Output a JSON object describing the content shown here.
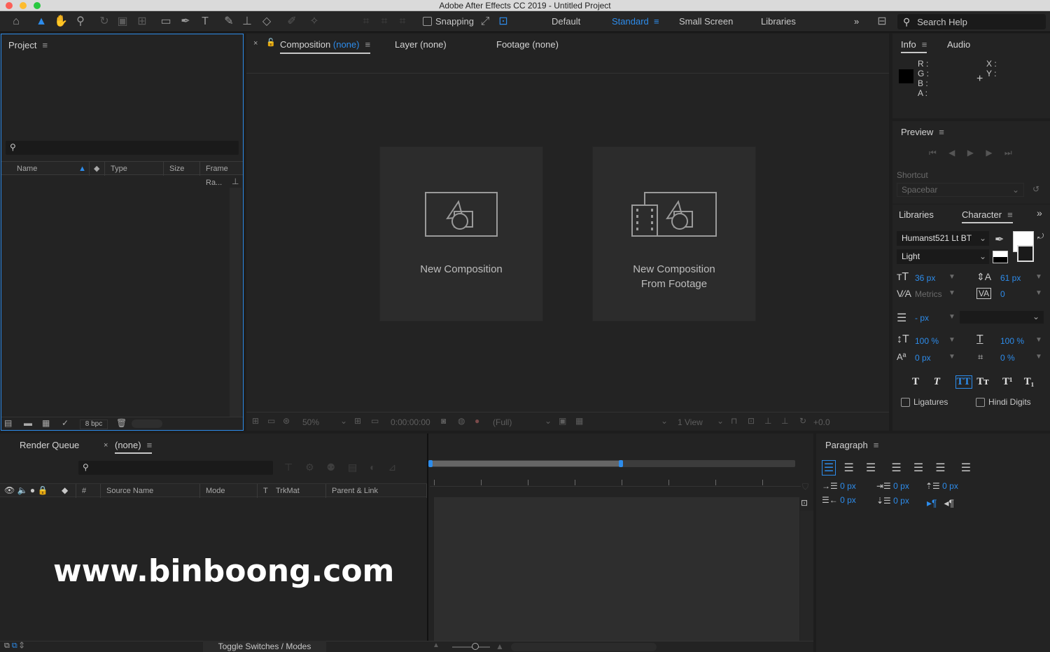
{
  "window": {
    "title": "Adobe After Effects CC 2019 - Untitled Project"
  },
  "toolbar": {
    "snapping_label": "Snapping",
    "workspaces": [
      "Default",
      "Standard",
      "Small Screen",
      "Libraries"
    ],
    "active_workspace": "Standard",
    "search_placeholder": "Search Help"
  },
  "project": {
    "tab_label": "Project",
    "columns": [
      "Name",
      "Type",
      "Size",
      "Frame Ra..."
    ],
    "bpc_label": "8 bpc"
  },
  "viewer": {
    "tabs": [
      {
        "prefix": "Composition",
        "value": "(none)"
      },
      {
        "prefix": "Layer",
        "value": "(none)"
      },
      {
        "prefix": "Footage",
        "value": "(none)"
      }
    ],
    "cards": [
      {
        "line1": "New Composition",
        "line2": ""
      },
      {
        "line1": "New Composition",
        "line2": "From Footage"
      }
    ],
    "zoom": "50%",
    "timecode": "0:00:00:00",
    "resolution": "(Full)",
    "views": "1 View",
    "exposure": "+0.0"
  },
  "info": {
    "tabs": [
      "Info",
      "Audio"
    ],
    "rgba_labels": [
      "R :",
      "G :",
      "B :",
      "A :"
    ],
    "xy_labels": [
      "X :",
      "Y :"
    ]
  },
  "preview": {
    "tab_label": "Preview",
    "shortcut_label": "Shortcut",
    "shortcut_value": "Spacebar"
  },
  "character": {
    "tabs": [
      "Libraries",
      "Character"
    ],
    "font_family": "Humanst521 Lt BT",
    "font_style": "Light",
    "font_size": "36 px",
    "leading": "61 px",
    "kerning": "Metrics",
    "tracking": "0",
    "stroke_width": "- px",
    "vert_scale": "100 %",
    "horiz_scale": "100 %",
    "baseline_shift": "0 px",
    "tsume": "0 %",
    "style_buttons": [
      "T",
      "T",
      "TT",
      "Tт",
      "T¹",
      "T₁"
    ],
    "ligatures_label": "Ligatures",
    "hindi_digits_label": "Hindi Digits"
  },
  "timeline": {
    "tabs": [
      "Render Queue",
      "(none)"
    ],
    "columns": [
      "#",
      "Source Name",
      "Mode",
      "T",
      "TrkMat",
      "Parent & Link"
    ],
    "toggle_label": "Toggle Switches / Modes"
  },
  "paragraph": {
    "tab_label": "Paragraph",
    "indent_values": [
      "0 px",
      "0 px",
      "0 px",
      "0 px",
      "0 px"
    ]
  },
  "watermark": "www.binboong.com",
  "colors": {
    "accent": "#2d8ceb",
    "panel_bg": "#232323",
    "app_bg": "#1d1d1d"
  }
}
